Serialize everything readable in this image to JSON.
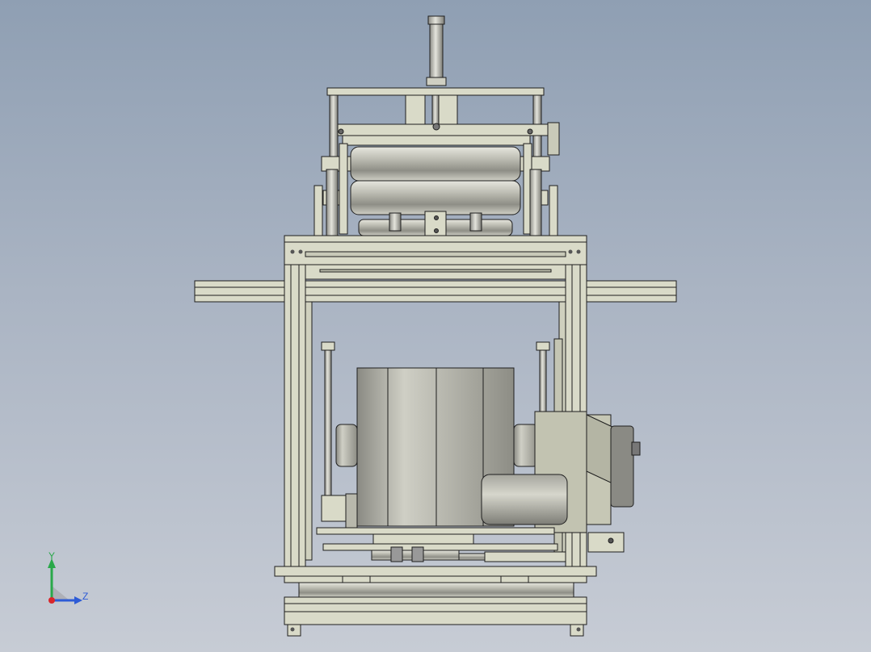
{
  "view": {
    "background_top": "#8f9fb3",
    "background_bottom": "#c7ccd5",
    "frame_color": "#d9dac8",
    "roller_color": "#b8b8ae",
    "edge_color": "#1e1e1e"
  },
  "triad": {
    "y_label": "Y",
    "z_label": "Z",
    "y_color": "#2aa84a",
    "z_color": "#2d5bd6",
    "origin_color": "#d9262b"
  },
  "parts": {
    "top_shaft": "top-shaft",
    "upper_roller": "upper-roller",
    "lower_roller": "lower-roller",
    "main_drum": "main-drum",
    "motor": "motor",
    "base_frame": "base-frame"
  }
}
